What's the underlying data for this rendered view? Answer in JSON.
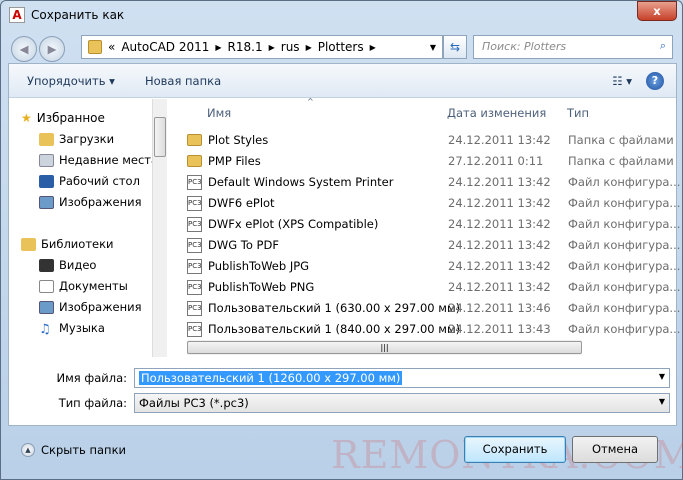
{
  "window": {
    "title": "Сохранить как",
    "close": "x",
    "app_icon": "A"
  },
  "nav": {
    "back": "◀",
    "forward": "▶",
    "overflow": "«",
    "breadcrumb": [
      "AutoCAD 2011",
      "R18.1",
      "rus",
      "Plotters"
    ],
    "search_placeholder": "Поиск: Plotters"
  },
  "toolbar": {
    "organize": "Упорядочить ▾",
    "new_folder": "Новая папка",
    "views": "☷ ▾",
    "help": "?"
  },
  "sidebar": {
    "favorites": "Избранное",
    "fav_items": [
      "Загрузки",
      "Недавние места",
      "Рабочий стол",
      "Изображения"
    ],
    "libraries": "Библиотеки",
    "lib_items": [
      "Видео",
      "Документы",
      "Изображения",
      "Музыка"
    ]
  },
  "columns": {
    "name": "Имя",
    "date": "Дата изменения",
    "type": "Тип"
  },
  "files": [
    {
      "name": "Plot Styles",
      "date": "24.12.2011 13:42",
      "type": "Папка с файлами",
      "kind": "folder"
    },
    {
      "name": "PMP Files",
      "date": "27.12.2011 0:11",
      "type": "Папка с файлами",
      "kind": "folder"
    },
    {
      "name": "Default Windows System Printer",
      "date": "24.12.2011 13:42",
      "type": "Файл конфигура...",
      "kind": "pc3"
    },
    {
      "name": "DWF6 ePlot",
      "date": "24.12.2011 13:42",
      "type": "Файл конфигура...",
      "kind": "pc3"
    },
    {
      "name": "DWFx ePlot (XPS Compatible)",
      "date": "24.12.2011 13:42",
      "type": "Файл конфигура...",
      "kind": "pc3"
    },
    {
      "name": "DWG To PDF",
      "date": "24.12.2011 13:42",
      "type": "Файл конфигура...",
      "kind": "pc3"
    },
    {
      "name": "PublishToWeb JPG",
      "date": "24.12.2011 13:42",
      "type": "Файл конфигура...",
      "kind": "pc3"
    },
    {
      "name": "PublishToWeb PNG",
      "date": "24.12.2011 13:42",
      "type": "Файл конфигура...",
      "kind": "pc3"
    },
    {
      "name": "Пользовательский 1 (630.00 x 297.00 мм)",
      "date": "24.12.2011 13:46",
      "type": "Файл конфигура...",
      "kind": "pc3"
    },
    {
      "name": "Пользовательский 1 (840.00 x 297.00 мм)",
      "date": "24.12.2011 13:43",
      "type": "Файл конфигура...",
      "kind": "pc3"
    }
  ],
  "form": {
    "filename_label": "Имя файла:",
    "filename_value": "Пользовательский 1 (1260.00 x 297.00 мм)",
    "filetype_label": "Тип файла:",
    "filetype_value": "Файлы PC3 (*.pc3)"
  },
  "footer": {
    "hide_folders": "Скрыть папки",
    "save": "Сохранить",
    "cancel": "Отмена"
  },
  "watermark": "REMONTKA.COM"
}
